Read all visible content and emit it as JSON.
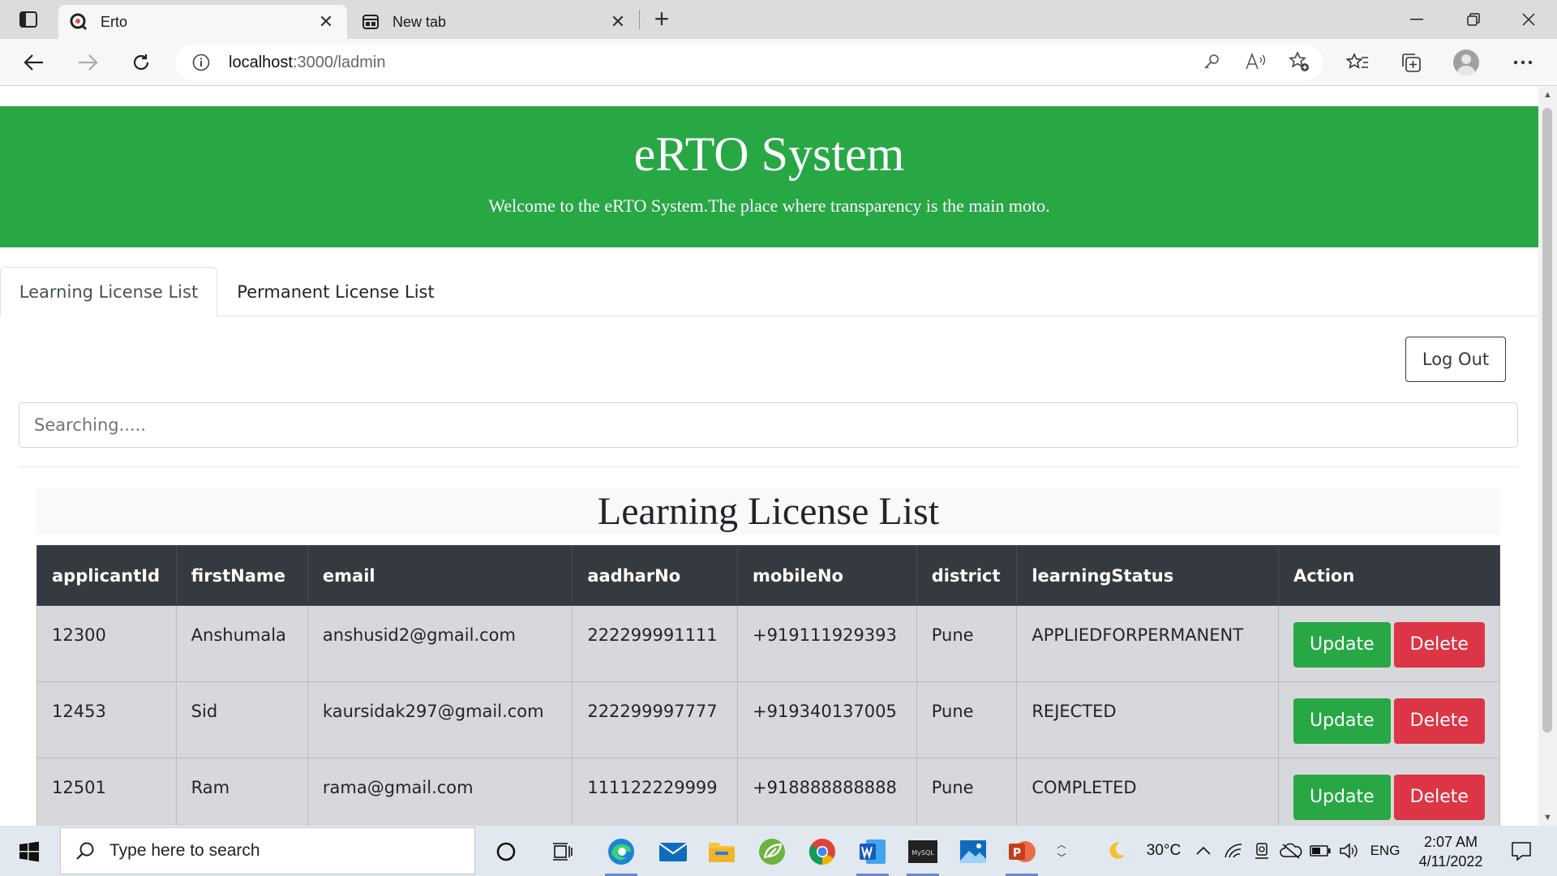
{
  "browser": {
    "tabs": [
      {
        "title": "Erto",
        "active": true
      },
      {
        "title": "New tab",
        "active": false
      }
    ],
    "url_host": "localhost",
    "url_path": ":3000/ladmin"
  },
  "page": {
    "header": {
      "title": "eRTO System",
      "subtitle": "Welcome to the eRTO System.The place where transparency is the main moto."
    },
    "nav_tabs": [
      {
        "label": "Learning License List",
        "active": true
      },
      {
        "label": "Permanent License List",
        "active": false
      }
    ],
    "logout_label": "Log Out",
    "search_placeholder": "Searching.....",
    "table_title": "Learning License List",
    "columns": [
      "applicantId",
      "firstName",
      "email",
      "aadharNo",
      "mobileNo",
      "district",
      "learningStatus",
      "Action"
    ],
    "rows": [
      {
        "applicantId": "12300",
        "firstName": "Anshumala",
        "email": "anshusid2@gmail.com",
        "aadharNo": "222299991111",
        "mobileNo": "+919111929393",
        "district": "Pune",
        "learningStatus": "APPLIEDFORPERMANENT"
      },
      {
        "applicantId": "12453",
        "firstName": "Sid",
        "email": "kaursidak297@gmail.com",
        "aadharNo": "222299997777",
        "mobileNo": "+919340137005",
        "district": "Pune",
        "learningStatus": "REJECTED"
      },
      {
        "applicantId": "12501",
        "firstName": "Ram",
        "email": "rama@gmail.com",
        "aadharNo": "111122229999",
        "mobileNo": "+918888888888",
        "district": "Pune",
        "learningStatus": "COMPLETED"
      }
    ],
    "update_label": "Update",
    "delete_label": "Delete"
  },
  "taskbar": {
    "search_placeholder": "Type here to search",
    "weather": "30°C",
    "language": "ENG",
    "time": "2:07 AM",
    "date": "4/11/2022"
  },
  "colors": {
    "header_green": "#28a745",
    "table_head": "#343a40",
    "row_bg": "#d6d8db",
    "update_btn": "#28a745",
    "delete_btn": "#dc3545"
  }
}
